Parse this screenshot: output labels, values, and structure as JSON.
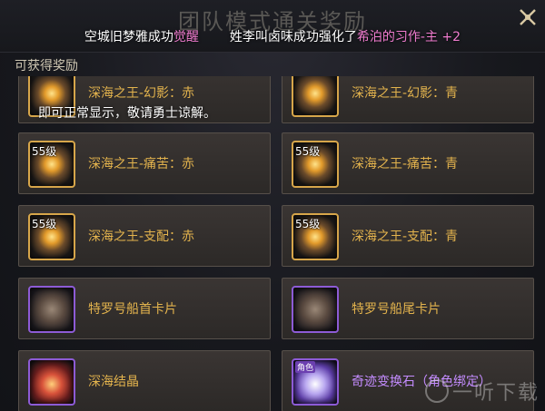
{
  "panel": {
    "title": "团队模式通关奖励",
    "subtitle": "可获得奖励"
  },
  "broadcast": {
    "part1": "空城旧梦雅成功",
    "part1_highlight": "觉醒",
    "part2": "姓李叫卤味成功强化了",
    "part2_highlight": "希泊的习作-主 +2"
  },
  "notice": "即可正常显示，敬请勇士谅解。",
  "rewards": [
    {
      "name": "深海之王-幻影：赤",
      "level": "",
      "icon": "phantom-red-icon"
    },
    {
      "name": "深海之王-幻影：青",
      "level": "",
      "icon": "phantom-blue-icon"
    },
    {
      "name": "深海之王-痛苦：赤",
      "level": "55级",
      "icon": "pain-red-icon"
    },
    {
      "name": "深海之王-痛苦：青",
      "level": "55级",
      "icon": "pain-blue-icon"
    },
    {
      "name": "深海之王-支配：赤",
      "level": "55级",
      "icon": "dominate-red-icon"
    },
    {
      "name": "深海之王-支配：青",
      "level": "55级",
      "icon": "dominate-blue-icon"
    },
    {
      "name": "特罗号船首卡片",
      "level": "",
      "icon": "ship-bow-card-icon"
    },
    {
      "name": "特罗号船尾卡片",
      "level": "",
      "icon": "ship-stern-card-icon"
    },
    {
      "name": "深海结晶",
      "level": "",
      "icon": "deep-sea-crystal-icon"
    },
    {
      "name": "奇迹变换石（角色绑定）",
      "level": "",
      "bound": "角色",
      "icon": "miracle-stone-icon"
    }
  ],
  "watermark": "一听下载",
  "colors": {
    "item_name": "#e3b34d",
    "highlight": "#f07ccf",
    "slot_border": "#d7a64a",
    "rare_border": "#8d5bd6"
  }
}
